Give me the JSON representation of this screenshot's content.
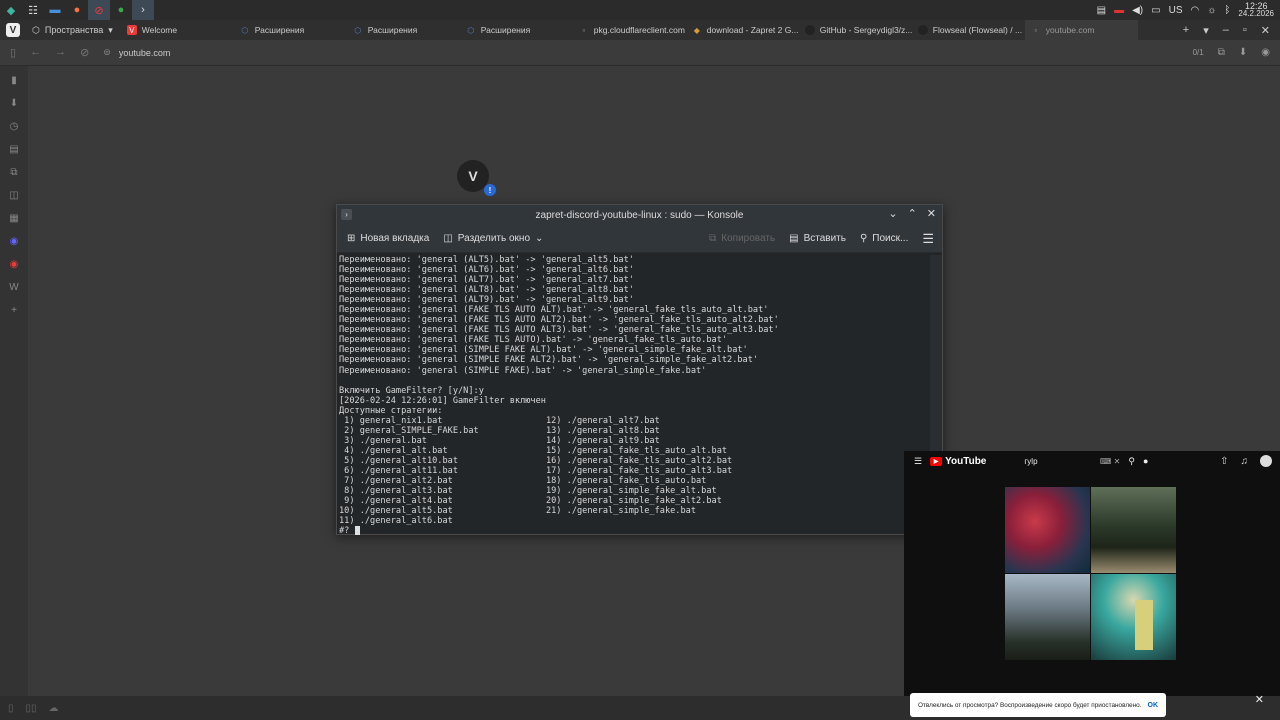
{
  "taskbar": {
    "apps": [
      "◆",
      "≡",
      "▬",
      "●",
      "⊘",
      "●",
      "›_"
    ],
    "layout": "US",
    "time": "12:26",
    "date": "24.2.2026"
  },
  "browser": {
    "spaces_label": "Пространства",
    "tabs": [
      {
        "label": "Welcome",
        "fav": "V",
        "color": "#ef3939"
      },
      {
        "label": "Расширения",
        "fav": "⬡",
        "color": "#5b7fbf"
      },
      {
        "label": "Расширения",
        "fav": "⬡",
        "color": "#5b7fbf"
      },
      {
        "label": "Расширения",
        "fav": "⬡",
        "color": "#5b7fbf"
      },
      {
        "label": "pkg.cloudflareclient.com",
        "fav": "▫",
        "color": "#777"
      },
      {
        "label": "download - Zapret 2 G...",
        "fav": "◆",
        "color": "#d39b3a"
      },
      {
        "label": "GitHub - Sergeydigl3/z...",
        "fav": "●",
        "color": "#222"
      },
      {
        "label": "Flowseal (Flowseal) / ...",
        "fav": "●",
        "color": "#222"
      },
      {
        "label": "youtube.com",
        "fav": "▫",
        "color": "#777"
      }
    ],
    "url": "youtube.com",
    "counter": "0/1"
  },
  "konsole": {
    "title": "zapret-discord-youtube-linux : sudo — Konsole",
    "new_tab": "Новая вкладка",
    "split": "Разделить окно",
    "copy": "Копировать",
    "paste": "Вставить",
    "find": "Поиск...",
    "lines": [
      "Переименовано: 'general (ALT5).bat' -> 'general_alt5.bat'",
      "Переименовано: 'general (ALT6).bat' -> 'general_alt6.bat'",
      "Переименовано: 'general (ALT7).bat' -> 'general_alt7.bat'",
      "Переименовано: 'general (ALT8).bat' -> 'general_alt8.bat'",
      "Переименовано: 'general (ALT9).bat' -> 'general_alt9.bat'",
      "Переименовано: 'general (FAKE TLS AUTO ALT).bat' -> 'general_fake_tls_auto_alt.bat'",
      "Переименовано: 'general (FAKE TLS AUTO ALT2).bat' -> 'general_fake_tls_auto_alt2.bat'",
      "Переименовано: 'general (FAKE TLS AUTO ALT3).bat' -> 'general_fake_tls_auto_alt3.bat'",
      "Переименовано: 'general (FAKE TLS AUTO).bat' -> 'general_fake_tls_auto.bat'",
      "Переименовано: 'general (SIMPLE FAKE ALT).bat' -> 'general_simple_fake_alt.bat'",
      "Переименовано: 'general (SIMPLE FAKE ALT2).bat' -> 'general_simple_fake_alt2.bat'",
      "Переименовано: 'general (SIMPLE FAKE).bat' -> 'general_simple_fake.bat'",
      "",
      "Включить GameFilter? [y/N]:y",
      "[2026-02-24 12:26:01] GameFilter включен",
      "Доступные стратегии:",
      " 1) general_nix1.bat                    12) ./general_alt7.bat",
      " 2) general_SIMPLE_FAKE.bat             13) ./general_alt8.bat",
      " 3) ./general.bat                       14) ./general_alt9.bat",
      " 4) ./general_alt.bat                   15) ./general_fake_tls_auto_alt.bat",
      " 5) ./general_alt10.bat                 16) ./general_fake_tls_auto_alt2.bat",
      " 6) ./general_alt11.bat                 17) ./general_fake_tls_auto_alt3.bat",
      " 7) ./general_alt2.bat                  18) ./general_fake_tls_auto.bat",
      " 8) ./general_alt3.bat                  19) ./general_simple_fake_alt.bat",
      " 9) ./general_alt4.bat                  20) ./general_simple_fake_alt2.bat",
      "10) ./general_alt5.bat                  21) ./general_simple_fake.bat",
      "11) ./general_alt6.bat"
    ],
    "prompt": "#? "
  },
  "youtube": {
    "logo": "YouTube",
    "search_value": "гуlр",
    "toast": "Отвлеклись от просмотра? Воспроизведение скоро будет приостановлено.",
    "toast_ok": "OK"
  }
}
